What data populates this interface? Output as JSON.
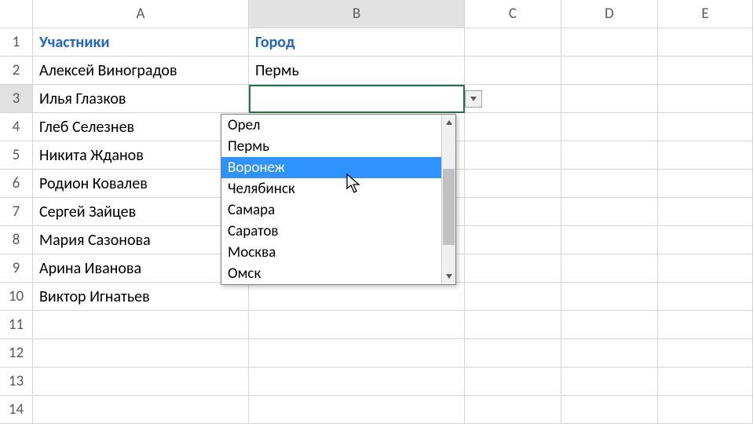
{
  "columns": [
    "A",
    "B",
    "C",
    "D",
    "E"
  ],
  "rows": [
    "1",
    "2",
    "3",
    "4",
    "5",
    "6",
    "7",
    "8",
    "9",
    "10",
    "11",
    "12",
    "13",
    "14"
  ],
  "headers": {
    "A": "Участники",
    "B": "Город"
  },
  "data": {
    "A": [
      "Алексей Виноградов",
      "Илья Глазков",
      "Глеб Селезнев",
      "Никита Жданов",
      "Родион Ковалев",
      "Сергей Зайцев",
      "Мария Сазонова",
      "Арина Иванова",
      "Виктор Игнатьев"
    ],
    "B": [
      "Пермь",
      "",
      "",
      "",
      "",
      "",
      "",
      "",
      ""
    ]
  },
  "active_cell": "B3",
  "dropdown": {
    "items": [
      "Орел",
      "Пермь",
      "Воронеж",
      "Челябинск",
      "Самара",
      "Саратов",
      "Москва",
      "Омск"
    ],
    "highlighted_index": 2
  }
}
